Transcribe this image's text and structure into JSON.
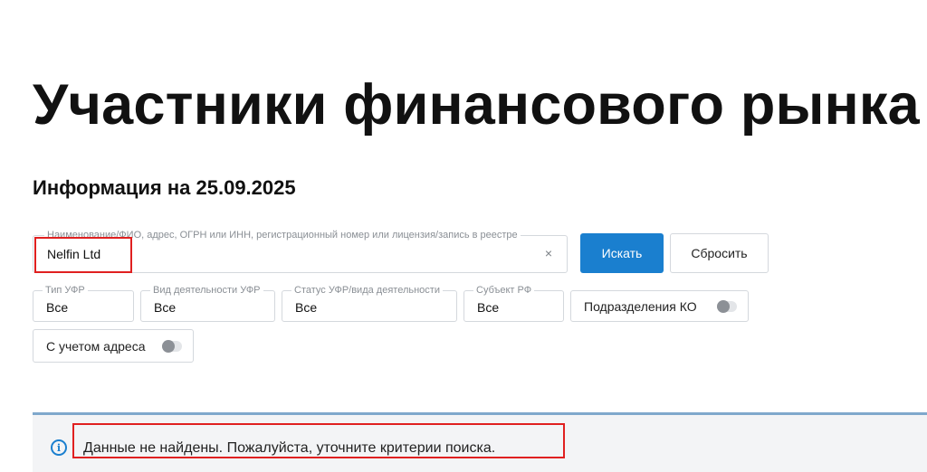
{
  "page": {
    "title": "Участники финансового рынка",
    "info_date": "Информация на 25.09.2025"
  },
  "search": {
    "legend": "Наименование/ФИО, адрес, ОГРН или ИНН, регистрационный номер или лицензия/запись в реестре",
    "value": "Nelfin Ltd",
    "clear_icon": "×",
    "search_button": "Искать",
    "reset_button": "Сбросить"
  },
  "filters": [
    {
      "label": "Тип УФР",
      "value": "Все"
    },
    {
      "label": "Вид деятельности УФР",
      "value": "Все"
    },
    {
      "label": "Статус УФР/вида деятельности",
      "value": "Все"
    },
    {
      "label": "Субъект РФ",
      "value": "Все"
    }
  ],
  "toggles": {
    "branches": {
      "label": "Подразделения КО",
      "on": false
    },
    "address": {
      "label": "С учетом адреса",
      "on": false
    }
  },
  "result": {
    "icon": "i",
    "message": "Данные не найдены. Пожалуйста, уточните критерии поиска."
  },
  "colors": {
    "accent": "#1a7fcf",
    "highlight": "#e02020",
    "panel_bg": "#f3f4f6",
    "panel_border": "#7fa8cc"
  }
}
